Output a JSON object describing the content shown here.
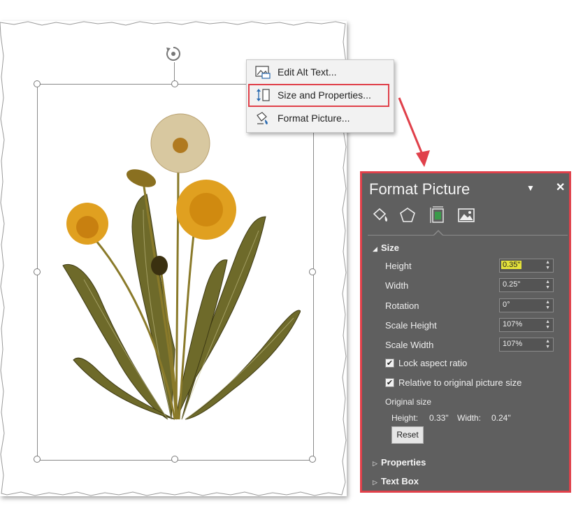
{
  "context_menu": {
    "items": [
      {
        "label": "Edit Alt Text...",
        "icon": "alt-text-icon"
      },
      {
        "label": "Size and Properties...",
        "icon": "size-properties-icon",
        "highlighted": true
      },
      {
        "label": "Format Picture...",
        "icon": "format-picture-icon"
      }
    ]
  },
  "pane": {
    "title": "Format Picture",
    "tabs": [
      "fill-line-icon",
      "effects-icon",
      "size-properties-icon",
      "picture-icon"
    ],
    "size_section": {
      "label": "Size",
      "fields": [
        {
          "label": "Height",
          "value": "0.35\"",
          "highlighted": true
        },
        {
          "label": "Width",
          "value": "0.25\""
        },
        {
          "label": "Rotation",
          "value": "0°"
        },
        {
          "label": "Scale Height",
          "value": "107%"
        },
        {
          "label": "Scale Width",
          "value": "107%"
        }
      ],
      "lock_aspect_ratio": {
        "label": "Lock aspect ratio",
        "checked": true
      },
      "relative_original": {
        "label": "Relative to original picture size",
        "checked": true
      },
      "original_size": {
        "label": "Original size",
        "height_label": "Height:",
        "height_value": "0.33\"",
        "width_label": "Width:",
        "width_value": "0.24\""
      },
      "reset_label": "Reset"
    },
    "properties_label": "Properties",
    "textbox_label": "Text Box"
  },
  "colors": {
    "highlight_border": "#e0404a",
    "pane_bg": "#5f5f5f",
    "value_highlight": "#e4e23a"
  }
}
